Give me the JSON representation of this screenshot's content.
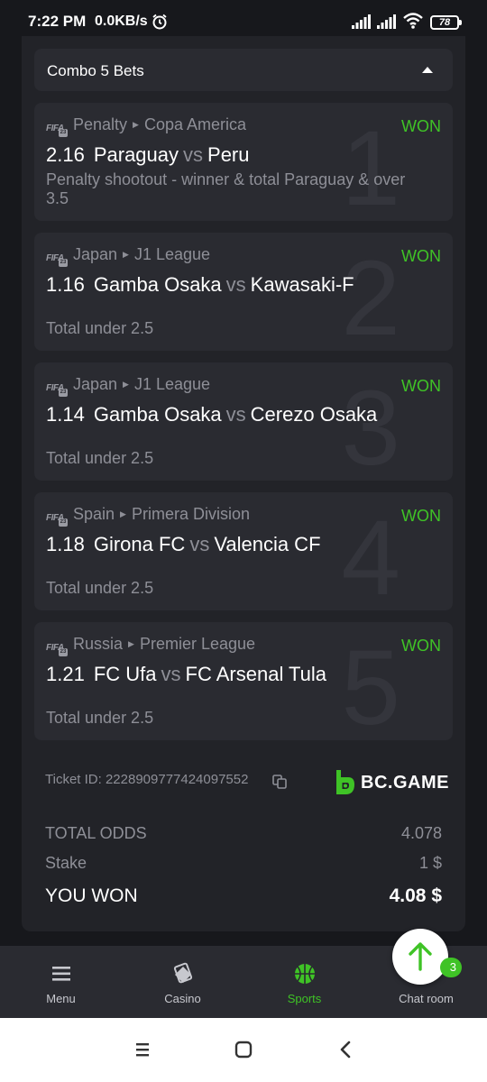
{
  "status_bar": {
    "time": "7:22 PM",
    "speed": "0.0KB/s",
    "battery": "78"
  },
  "combo": {
    "title": "Combo 5 Bets"
  },
  "bets": [
    {
      "number": "1",
      "league": "Penalty",
      "competition": "Copa America",
      "status": "WON",
      "odds": "2.16",
      "home": "Paraguay",
      "vs": "vs",
      "away": "Peru",
      "market": "Penalty shootout - winner & total Paraguay & over 3.5"
    },
    {
      "number": "2",
      "league": "Japan",
      "competition": "J1 League",
      "status": "WON",
      "odds": "1.16",
      "home": "Gamba Osaka",
      "vs": "vs",
      "away": "Kawasaki-F",
      "market": "Total under 2.5"
    },
    {
      "number": "3",
      "league": "Japan",
      "competition": "J1 League",
      "status": "WON",
      "odds": "1.14",
      "home": "Gamba Osaka",
      "vs": "vs",
      "away": "Cerezo Osaka",
      "market": "Total under 2.5"
    },
    {
      "number": "4",
      "league": "Spain",
      "competition": "Primera Division",
      "status": "WON",
      "odds": "1.18",
      "home": "Girona FC",
      "vs": "vs",
      "away": "Valencia CF",
      "market": "Total under 2.5"
    },
    {
      "number": "5",
      "league": "Russia",
      "competition": "Premier League",
      "status": "WON",
      "odds": "1.21",
      "home": "FC Ufa",
      "vs": "vs",
      "away": "FC Arsenal Tula",
      "market": "Total under 2.5"
    }
  ],
  "fifa_icon_text": "FIFA",
  "ticket": {
    "id_text": "Ticket ID: 2228909777424097552",
    "brand": "BC.GAME"
  },
  "summary": {
    "total_odds_label": "TOTAL ODDS",
    "total_odds_value": "4.078",
    "stake_label": "Stake",
    "stake_value": "1 $",
    "won_label": "YOU WON",
    "won_value": "4.08 $"
  },
  "nav": {
    "items": [
      {
        "label": "Menu",
        "icon": "menu-icon"
      },
      {
        "label": "Casino",
        "icon": "casino-icon"
      },
      {
        "label": "Sports",
        "icon": "basketball-icon",
        "active": true
      },
      {
        "label": "Chat room",
        "icon": "chat-icon"
      }
    ],
    "chat_badge": "3"
  },
  "colors": {
    "accent": "#3fc326",
    "background": "#17181c",
    "card": "#2a2b31",
    "muted": "#8e8f97"
  }
}
